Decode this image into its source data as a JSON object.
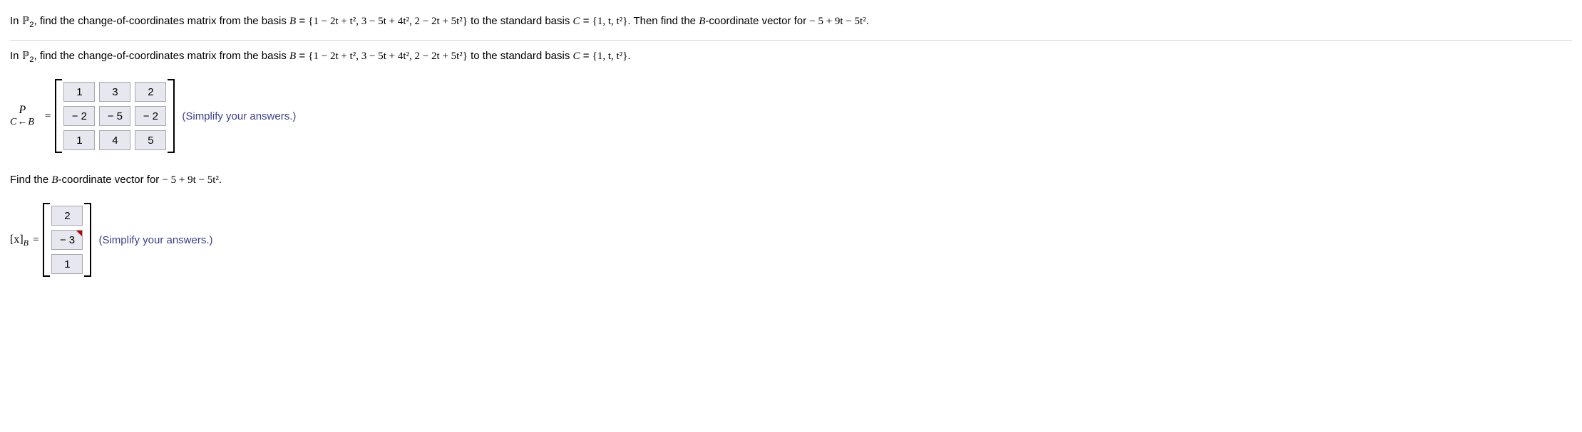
{
  "problem": {
    "lead_in": "In ",
    "space_symbol": "ℙ",
    "space_sub": "2",
    "text_a": ", find the change-of-coordinates matrix from the basis ",
    "B_label": "B",
    "equals": " = ",
    "B_set": "{1 − 2t + t², 3 − 5t + 4t², 2 − 2t + 5t²}",
    "text_b": " to the standard basis ",
    "C_label": "C",
    "C_set": "{1, t, t²}",
    "text_c": ". Then find the ",
    "text_d": "-coordinate vector for ",
    "target_poly": " − 5 + 9t − 5t²",
    "period": "."
  },
  "subprompt": {
    "lead_in": "In ",
    "space_symbol": "ℙ",
    "space_sub": "2",
    "text_a": ", find the change-of-coordinates matrix from the basis ",
    "B_label": "B",
    "equals": " = ",
    "B_set": "{1 − 2t + t², 3 − 5t + 4t², 2 − 2t + 5t²}",
    "text_b": " to the standard basis ",
    "C_label": "C",
    "C_set": "{1, t, t²}",
    "period": "."
  },
  "matrix_P": {
    "lhs_top": "P",
    "lhs_bottom": "C←B",
    "eq": "=",
    "rows": [
      [
        "1",
        "3",
        "2"
      ],
      [
        "− 2",
        "− 5",
        "− 2"
      ],
      [
        "1",
        "4",
        "5"
      ]
    ],
    "hint": "(Simplify your answers.)"
  },
  "find_vec_text": {
    "a": "Find the ",
    "b": "-coordinate vector for ",
    "poly": " − 5 + 9t − 5t²",
    "period": "."
  },
  "vector_xB": {
    "label_open": "[x]",
    "label_sub": "B",
    "eq": "=",
    "entries": [
      "2",
      "− 3",
      "1"
    ],
    "marked_index": 1,
    "hint": "(Simplify your answers.)"
  },
  "chart_data": {
    "type": "table",
    "title": "Change-of-coordinates matrix P (C←B) and [x]_B",
    "matrix_P": [
      [
        1,
        3,
        2
      ],
      [
        -2,
        -5,
        -2
      ],
      [
        1,
        4,
        5
      ]
    ],
    "x_B": [
      2,
      -3,
      1
    ]
  }
}
